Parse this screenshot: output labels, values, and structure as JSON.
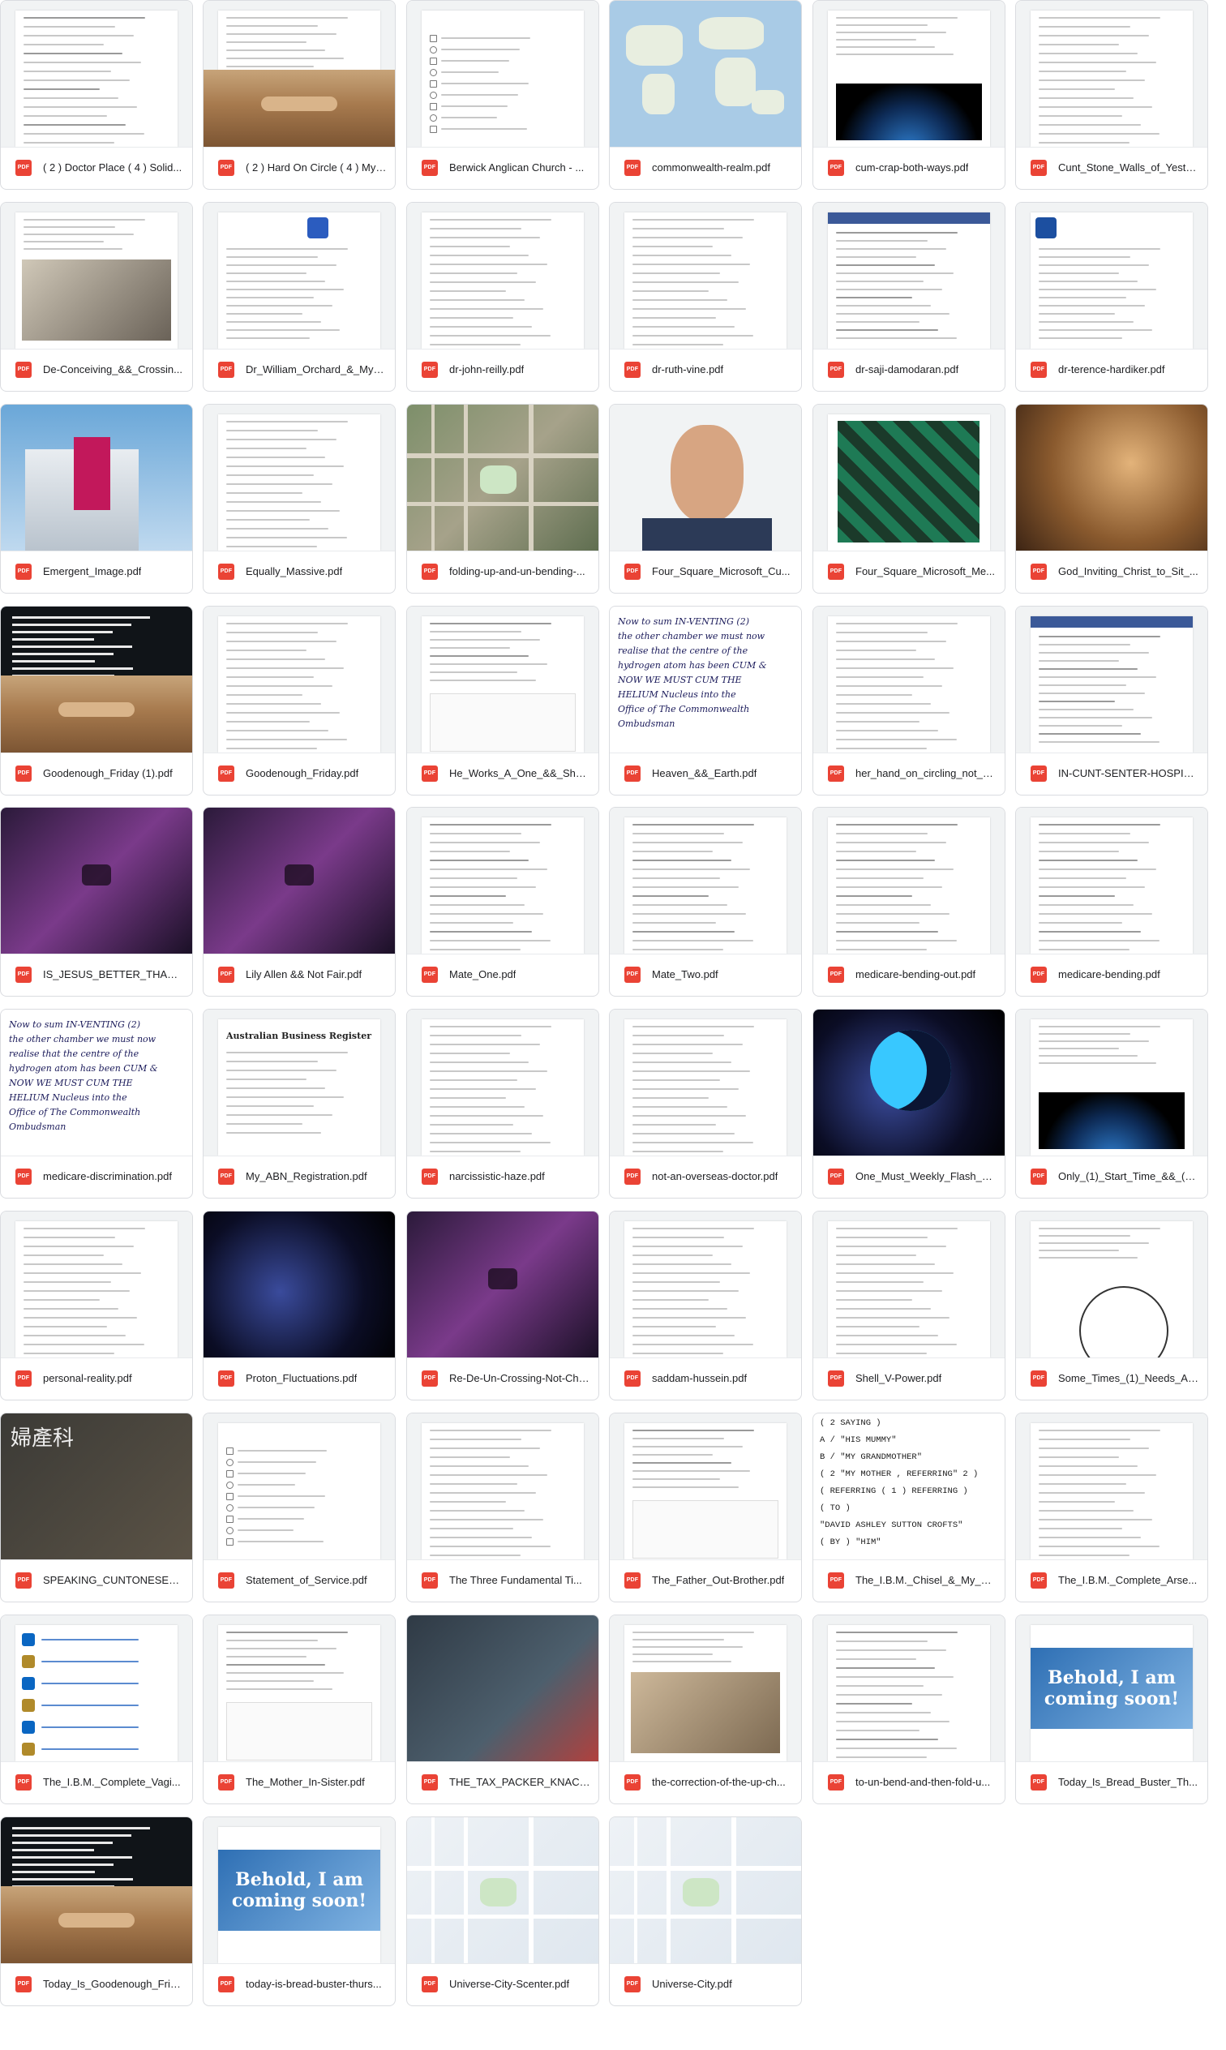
{
  "file_type_label": "PDF",
  "files": [
    {
      "name": "( 2 ) Doctor Place ( 4 ) Solid...",
      "thumb": "doc-list"
    },
    {
      "name": "( 2 ) Hard On Circle ( 4 ) My ...",
      "thumb": "doc-hand"
    },
    {
      "name": "Berwick Anglican Church - ...",
      "thumb": "form"
    },
    {
      "name": "commonwealth-realm.pdf",
      "thumb": "worldmap"
    },
    {
      "name": "cum-crap-both-ways.pdf",
      "thumb": "doc-earth"
    },
    {
      "name": "Cunt_Stone_Walls_of_Yeste...",
      "thumb": "doc-text"
    },
    {
      "name": "De-Conceiving_&&_Crossin...",
      "thumb": "social-photo"
    },
    {
      "name": "Dr_William_Orchard_&_My_...",
      "thumb": "letter-logo"
    },
    {
      "name": "dr-john-reilly.pdf",
      "thumb": "letter"
    },
    {
      "name": "dr-ruth-vine.pdf",
      "thumb": "letter-links"
    },
    {
      "name": "dr-saji-damodaran.pdf",
      "thumb": "web-shot"
    },
    {
      "name": "dr-terence-hardiker.pdf",
      "thumb": "hospital-letter"
    },
    {
      "name": "Emergent_Image.pdf",
      "thumb": "hospital-photo"
    },
    {
      "name": "Equally_Massive.pdf",
      "thumb": "doc-cross"
    },
    {
      "name": "folding-up-and-un-bending-...",
      "thumb": "aerial"
    },
    {
      "name": "Four_Square_Microsoft_Cu...",
      "thumb": "portrait"
    },
    {
      "name": "Four_Square_Microsoft_Me...",
      "thumb": "social-boxes"
    },
    {
      "name": "God_Inviting_Christ_to_Sit_...",
      "thumb": "painting"
    },
    {
      "name": "Goodenough_Friday (1).pdf",
      "thumb": "dark-hand"
    },
    {
      "name": "Goodenough_Friday.pdf",
      "thumb": "letter"
    },
    {
      "name": "He_Works_A_One_&&_She_...",
      "thumb": "social-text"
    },
    {
      "name": "Heaven_&&_Earth.pdf",
      "thumb": "handwriting"
    },
    {
      "name": "her_hand_on_circling_not_b...",
      "thumb": "doc-text"
    },
    {
      "name": "IN-CUNT-SENTER-HOSPITA...",
      "thumb": "web-shot"
    },
    {
      "name": "IS_JESUS_BETTER_THAN_...",
      "thumb": "video-purple"
    },
    {
      "name": "Lily Allen && Not Fair.pdf",
      "thumb": "video-purple"
    },
    {
      "name": "Mate_One.pdf",
      "thumb": "email"
    },
    {
      "name": "Mate_Two.pdf",
      "thumb": "email"
    },
    {
      "name": "medicare-bending-out.pdf",
      "thumb": "email"
    },
    {
      "name": "medicare-bending.pdf",
      "thumb": "email"
    },
    {
      "name": "medicare-discrimination.pdf",
      "thumb": "handwriting"
    },
    {
      "name": "My_ABN_Registration.pdf",
      "thumb": "abn"
    },
    {
      "name": "narcissistic-haze.pdf",
      "thumb": "paper"
    },
    {
      "name": "not-an-overseas-doctor.pdf",
      "thumb": "letter"
    },
    {
      "name": "One_Must_Weekly_Flash_M...",
      "thumb": "moon-star"
    },
    {
      "name": "Only_(1)_Start_Time_&&_(2...",
      "thumb": "doc-earth"
    },
    {
      "name": "personal-reality.pdf",
      "thumb": "doc-text"
    },
    {
      "name": "Proton_Fluctuations.pdf",
      "thumb": "space"
    },
    {
      "name": "Re-De-Un-Crossing-Not-Chr...",
      "thumb": "video-purple"
    },
    {
      "name": "saddam-hussein.pdf",
      "thumb": "doc-text"
    },
    {
      "name": "Shell_V-Power.pdf",
      "thumb": "doc-text"
    },
    {
      "name": "Some_Times_(1)_Needs_A_...",
      "thumb": "diagram"
    },
    {
      "name": "SPEAKING_CUNTONESE_I...",
      "thumb": "chinese-sign"
    },
    {
      "name": "Statement_of_Service.pdf",
      "thumb": "form"
    },
    {
      "name": "The Three Fundamental Ti...",
      "thumb": "letter"
    },
    {
      "name": "The_Father_Out-Brother.pdf",
      "thumb": "social-text"
    },
    {
      "name": "The_I.B.M._Chisel_&_My_Si...",
      "thumb": "big-text"
    },
    {
      "name": "The_I.B.M._Complete_Arse...",
      "thumb": "doc-text"
    },
    {
      "name": "The_I.B.M._Complete_Vagi...",
      "thumb": "linkedin-list"
    },
    {
      "name": "The_Mother_In-Sister.pdf",
      "thumb": "social-text"
    },
    {
      "name": "THE_TAX_PACKER_KNACK...",
      "thumb": "tax-photo"
    },
    {
      "name": "the-correction-of-the-up-ch...",
      "thumb": "social-book"
    },
    {
      "name": "to-un-bend-and-then-fold-u...",
      "thumb": "email"
    },
    {
      "name": "Today_Is_Bread_Buster_Th...",
      "thumb": "behold"
    },
    {
      "name": "Today_Is_Goodenough_Frid...",
      "thumb": "dark-hand"
    },
    {
      "name": "today-is-bread-buster-thurs...",
      "thumb": "behold"
    },
    {
      "name": "Universe-City-Scenter.pdf",
      "thumb": "streetmap"
    },
    {
      "name": "Universe-City.pdf",
      "thumb": "streetmap"
    }
  ],
  "thumb_text": {
    "behold": "Behold, I am coming soon!",
    "abn_title": "Australian Business Register",
    "chinese_sign": "婦產科",
    "big_text_lines": [
      "( 2   SAYING )",
      "A /   \"HIS MUMMY\"",
      "B /   \"MY GRANDMOTHER\"",
      "( 2   \"MY MOTHER , REFERRING\"  2 )",
      "( REFERRING  ( 1 )  REFERRING )",
      "( TO )",
      "\"DAVID ASHLEY SUTTON CROFTS\"",
      "( BY )  \"HIM\""
    ],
    "handwriting_lines": [
      "Now  to  sum  IN-VENTING  (2)",
      "the  other  chamber  we  must  now",
      "realise  that  the  centre  of  the",
      "hydrogen  atom  has  been  CUM  &",
      "NOW  WE  MUST  CUM  THE",
      "HELIUM  Nucleus  into  the",
      "Office  of  The  Commonwealth  Ombudsman"
    ]
  }
}
